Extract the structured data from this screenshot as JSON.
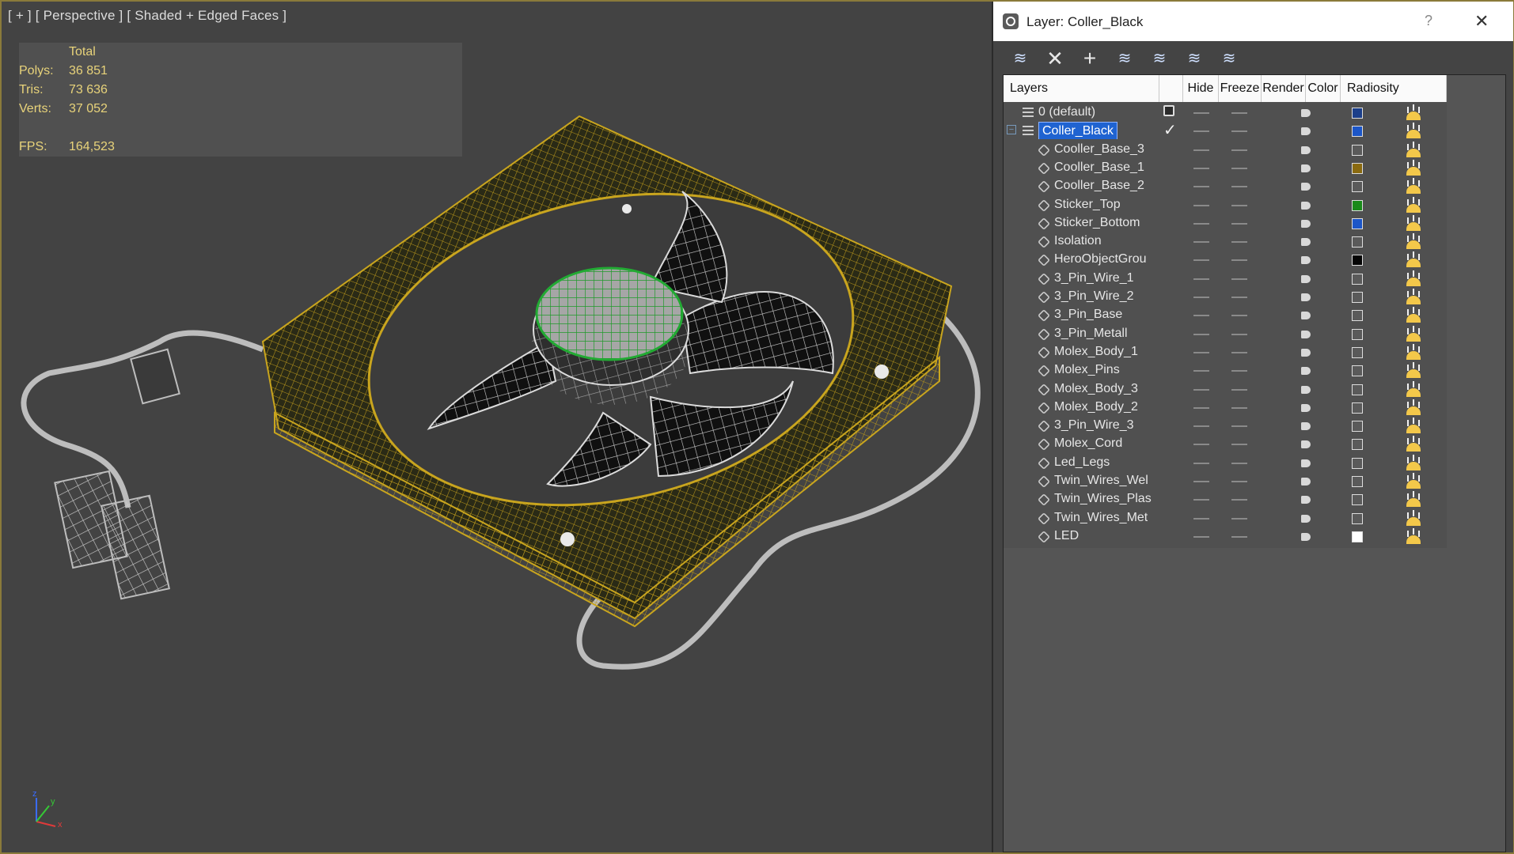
{
  "viewport": {
    "label": "[ + ] [ Perspective ] [ Shaded + Edged Faces ]",
    "stats": {
      "header": "Total",
      "polys_label": "Polys:",
      "polys_value": "36 851",
      "tris_label": "Tris:",
      "tris_value": "73 636",
      "verts_label": "Verts:",
      "verts_value": "37 052",
      "fps_label": "FPS:",
      "fps_value": "164,523"
    },
    "axis": {
      "x": "x",
      "y": "y",
      "z": "z"
    }
  },
  "panel": {
    "title": "Layer: Coller_Black",
    "help": "?",
    "close": "✕",
    "toolbar": {
      "new_layer": "≋",
      "delete": "✕",
      "add": "+",
      "select": "≋",
      "highlight": "≋",
      "hide_all": "≋",
      "freeze_all": "≋"
    },
    "columns": {
      "layers": "Layers",
      "hide": "Hide",
      "freeze": "Freeze",
      "render": "Render",
      "color": "Color",
      "radiosity": "Radiosity"
    },
    "rows": [
      {
        "name": "0 (default)",
        "kind": "layer",
        "color": "#1c3f8a"
      },
      {
        "name": "Coller_Black",
        "kind": "layer",
        "color": "#1c56c8",
        "selected": true
      },
      {
        "name": "Cooller_Base_3",
        "kind": "object",
        "color": "#5a5a5a"
      },
      {
        "name": "Cooller_Base_1",
        "kind": "object",
        "color": "#8a6a10"
      },
      {
        "name": "Cooller_Base_2",
        "kind": "object",
        "color": "#5a5a5a"
      },
      {
        "name": "Sticker_Top",
        "kind": "object",
        "color": "#1a8a1a"
      },
      {
        "name": "Sticker_Bottom",
        "kind": "object",
        "color": "#1c56c8"
      },
      {
        "name": "Isolation",
        "kind": "object",
        "color": "#5a5a5a"
      },
      {
        "name": "HeroObjectGrou",
        "kind": "object",
        "color": "#050505"
      },
      {
        "name": "3_Pin_Wire_1",
        "kind": "object",
        "color": "#5a5a5a"
      },
      {
        "name": "3_Pin_Wire_2",
        "kind": "object",
        "color": "#5a5a5a"
      },
      {
        "name": "3_Pin_Base",
        "kind": "object",
        "color": "#5a5a5a"
      },
      {
        "name": "3_Pin_Metall",
        "kind": "object",
        "color": "#5a5a5a"
      },
      {
        "name": "Molex_Body_1",
        "kind": "object",
        "color": "#5a5a5a"
      },
      {
        "name": "Molex_Pins",
        "kind": "object",
        "color": "#5a5a5a"
      },
      {
        "name": "Molex_Body_3",
        "kind": "object",
        "color": "#5a5a5a"
      },
      {
        "name": "Molex_Body_2",
        "kind": "object",
        "color": "#5a5a5a"
      },
      {
        "name": "3_Pin_Wire_3",
        "kind": "object",
        "color": "#5a5a5a"
      },
      {
        "name": "Molex_Cord",
        "kind": "object",
        "color": "#5a5a5a"
      },
      {
        "name": "Led_Legs",
        "kind": "object",
        "color": "#5a5a5a"
      },
      {
        "name": "Twin_Wires_Wel",
        "kind": "object",
        "color": "#5a5a5a"
      },
      {
        "name": "Twin_Wires_Plas",
        "kind": "object",
        "color": "#5a5a5a"
      },
      {
        "name": "Twin_Wires_Met",
        "kind": "object",
        "color": "#5a5a5a"
      },
      {
        "name": "LED",
        "kind": "object",
        "color": "#ffffff"
      }
    ]
  }
}
